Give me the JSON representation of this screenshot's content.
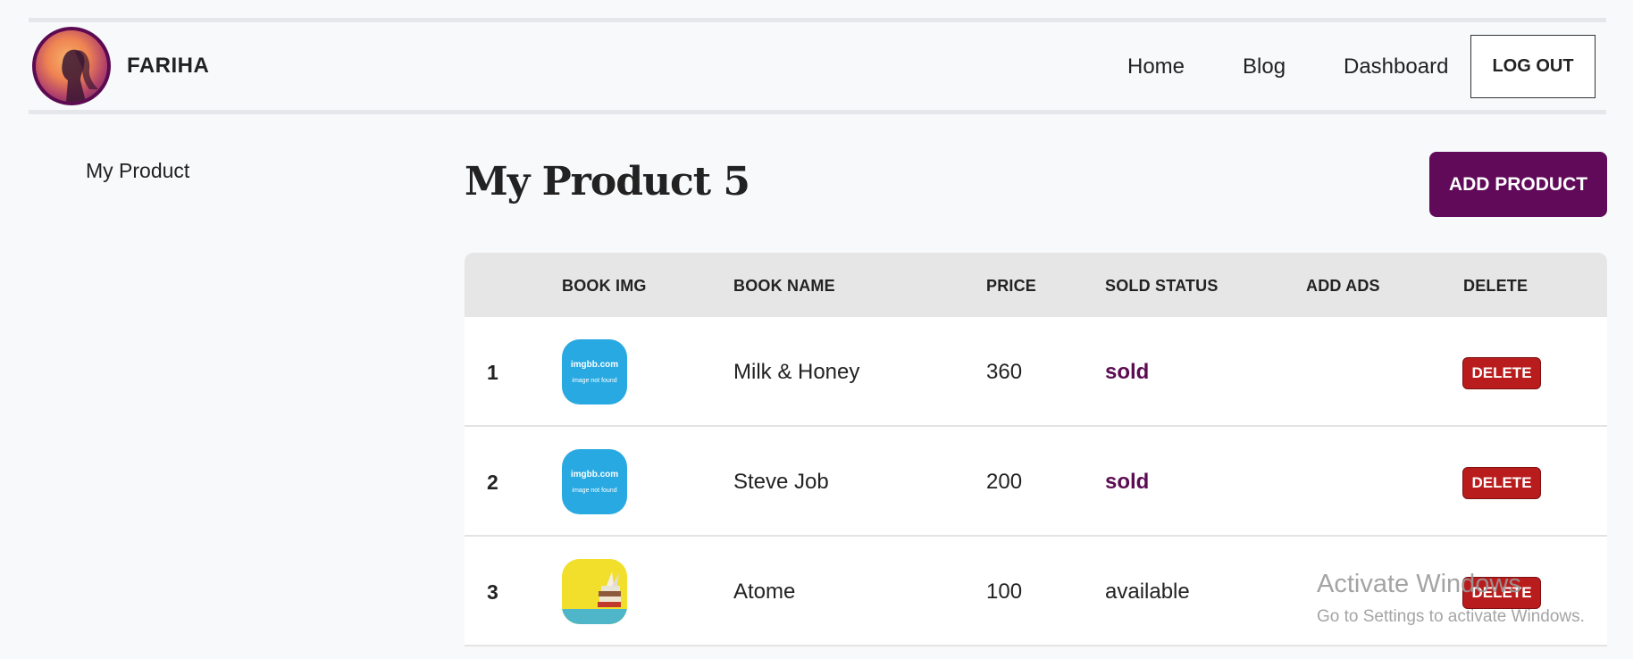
{
  "navbar": {
    "brand": "FARIHA",
    "links": [
      "Home",
      "Blog",
      "Dashboard"
    ],
    "logout_label": "LOG OUT"
  },
  "sidebar": {
    "items": [
      {
        "label": "My Product"
      }
    ]
  },
  "main": {
    "title": "My Product 5",
    "add_button_label": "ADD PRODUCT",
    "table": {
      "headers": [
        "",
        "BOOK IMG",
        "BOOK NAME",
        "PRICE",
        "SOLD STATUS",
        "ADD ADS",
        "DELETE"
      ],
      "rows": [
        {
          "index": "1",
          "image": {
            "type": "placeholder",
            "title": "imgbb.com",
            "subtitle": "image not found"
          },
          "name": "Milk & Honey",
          "price": "360",
          "status": "sold",
          "delete_label": "DELETE"
        },
        {
          "index": "2",
          "image": {
            "type": "placeholder",
            "title": "imgbb.com",
            "subtitle": "image not found"
          },
          "name": "Steve Job",
          "price": "200",
          "status": "sold",
          "delete_label": "DELETE"
        },
        {
          "index": "3",
          "image": {
            "type": "photo",
            "title": "",
            "subtitle": ""
          },
          "name": "Atome",
          "price": "100",
          "status": "available",
          "delete_label": "DELETE"
        }
      ]
    }
  },
  "watermark": {
    "title": "Activate Windows",
    "subtitle": "Go to Settings to activate Windows."
  },
  "colors": {
    "brand_purple": "#600a59",
    "delete_red": "#b91c1c",
    "placeholder_blue": "#29a9e1"
  }
}
